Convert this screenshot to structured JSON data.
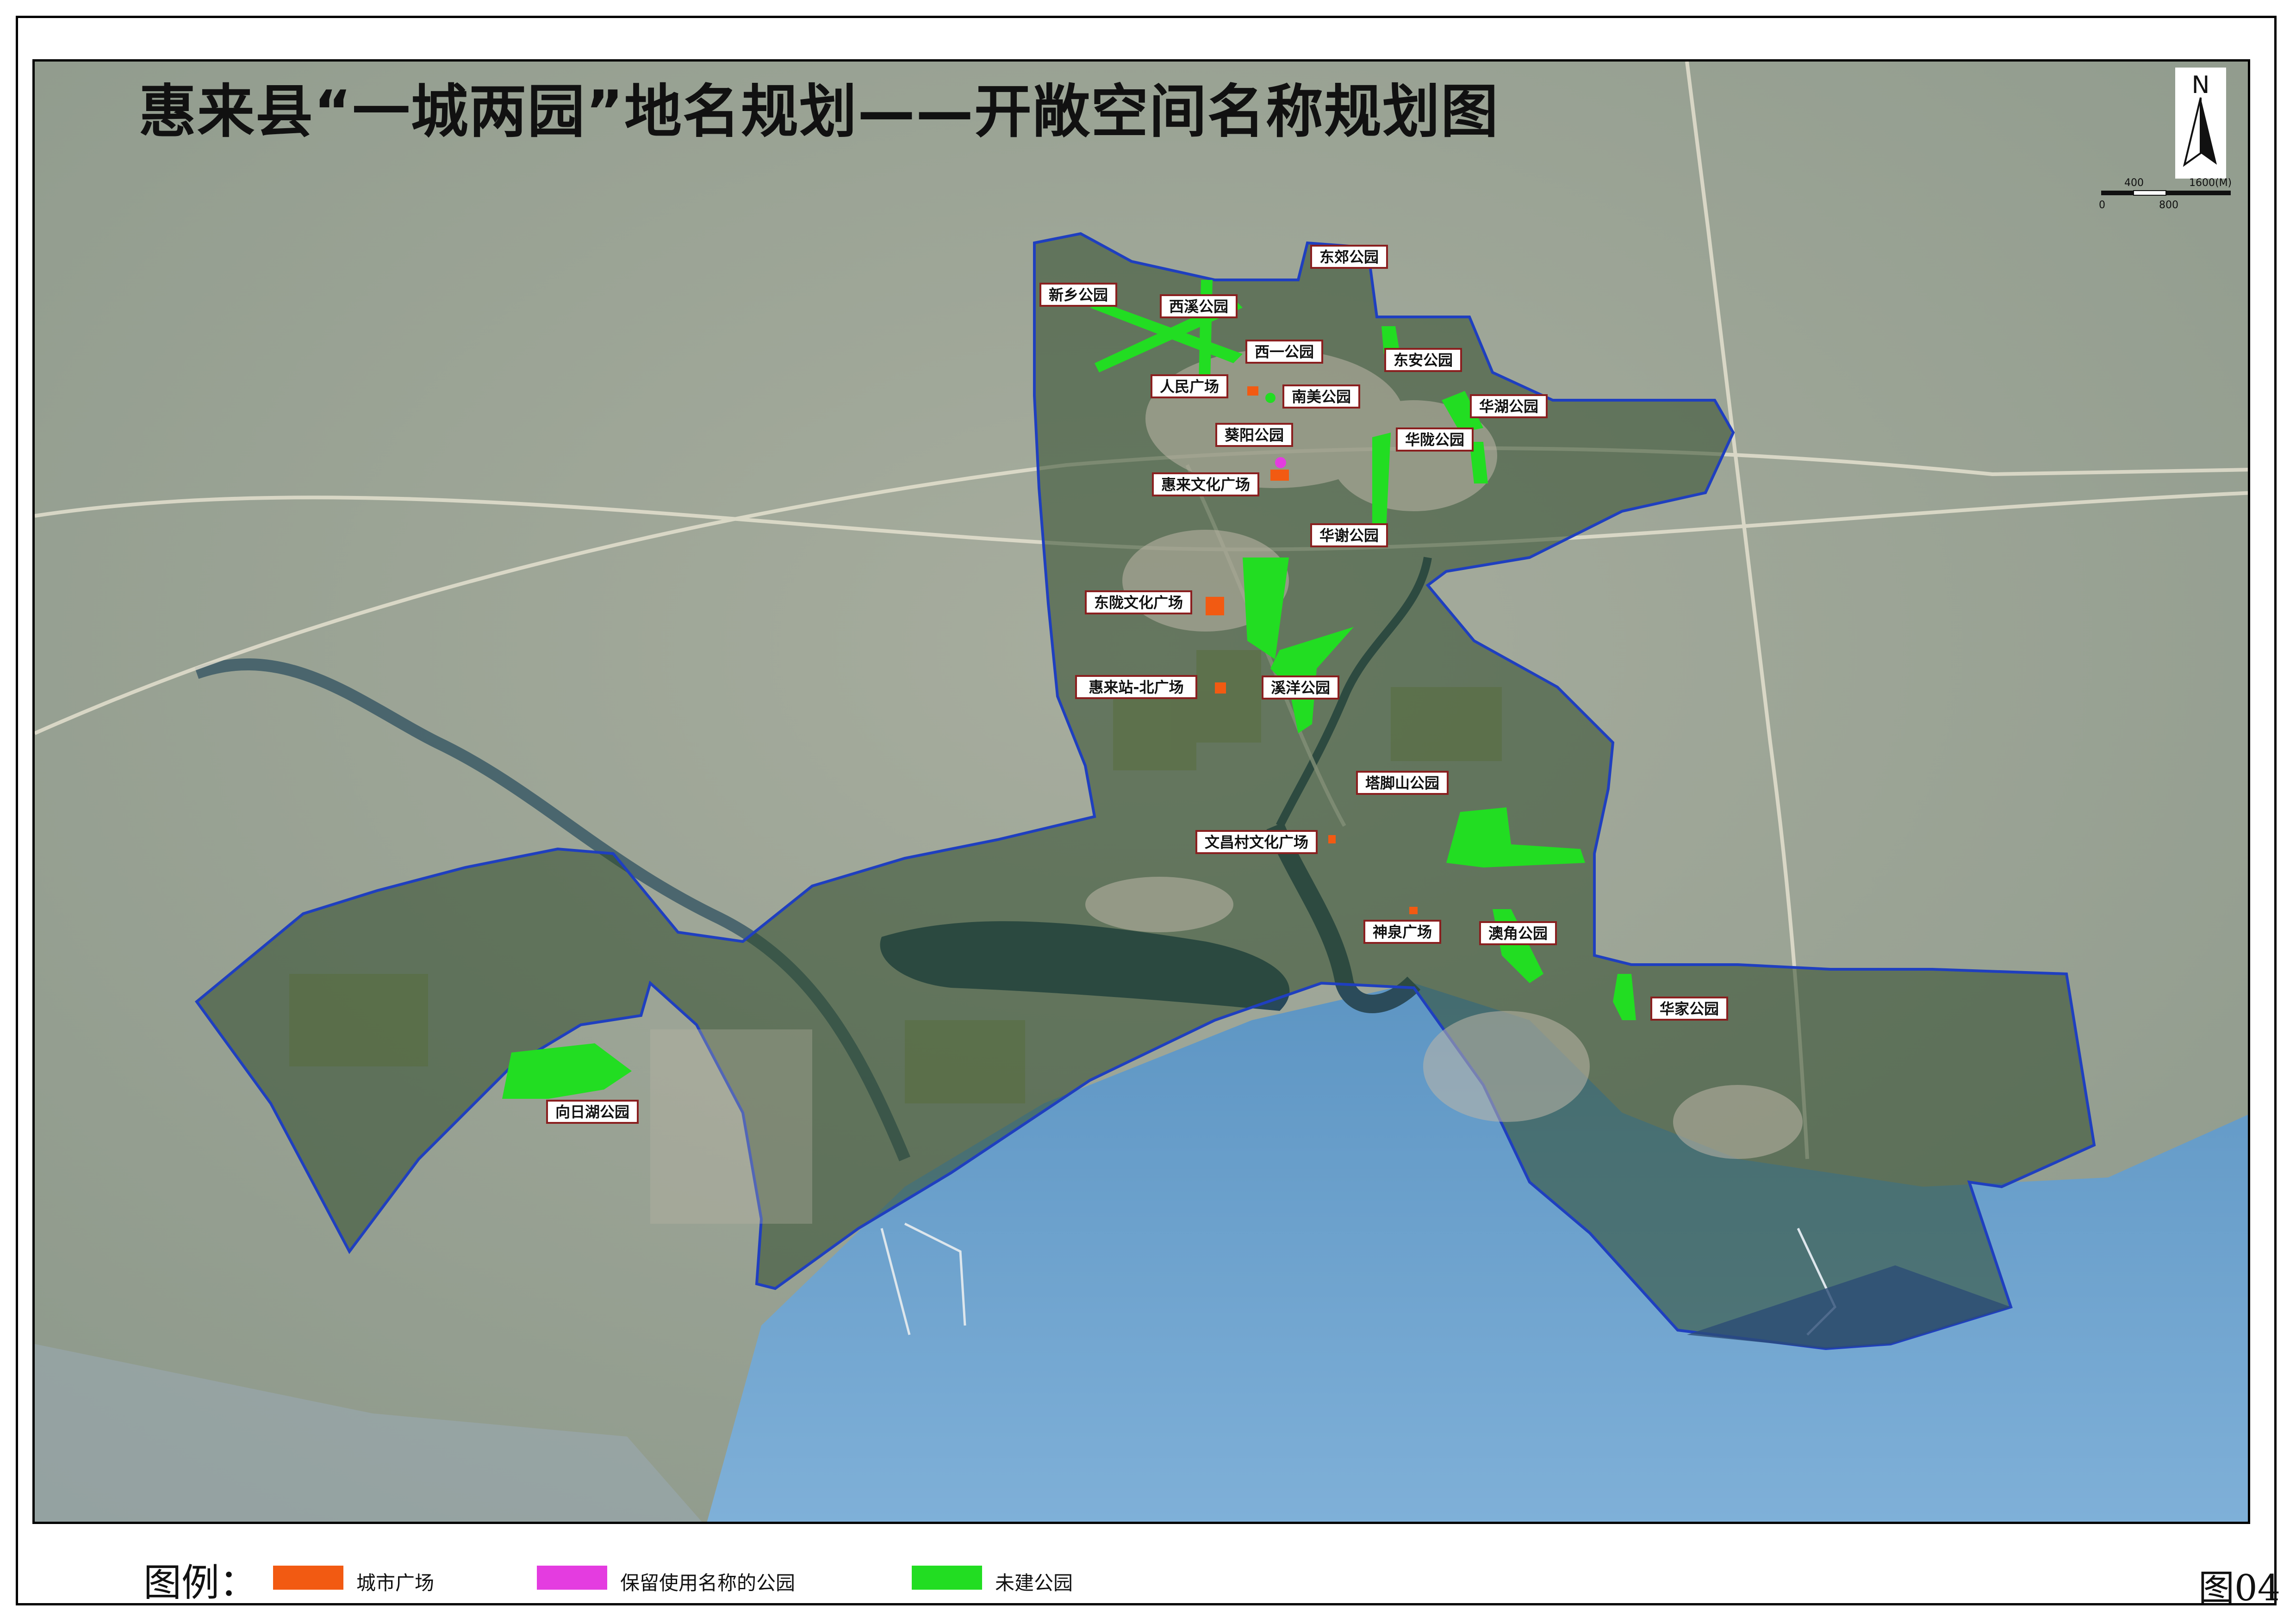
{
  "map": {
    "title": "惠来县“一城两园”地名规划——开敞空间名称规划图",
    "north_label": "N",
    "scale": {
      "tick_top": "400",
      "tick_right": "1600(M)",
      "tick_bottom_left": "0",
      "tick_bottom_mid": "800"
    },
    "colors": {
      "city_plaza": "#f25a12",
      "retained_park": "#e43ce0",
      "unbuilt_park": "#22dd22",
      "boundary": "#1f3fbf",
      "sea": "#4f88bb"
    },
    "places": [
      {
        "name": "东郊公园",
        "type": "park"
      },
      {
        "name": "新乡公园",
        "type": "park"
      },
      {
        "name": "西溪公园",
        "type": "park"
      },
      {
        "name": "西一公园",
        "type": "park"
      },
      {
        "name": "东安公园",
        "type": "park"
      },
      {
        "name": "人民广场",
        "type": "plaza"
      },
      {
        "name": "南美公园",
        "type": "park"
      },
      {
        "name": "华湖公园",
        "type": "park"
      },
      {
        "name": "葵阳公园",
        "type": "retained"
      },
      {
        "name": "华陇公园",
        "type": "park"
      },
      {
        "name": "惠来文化广场",
        "type": "plaza"
      },
      {
        "name": "华谢公园",
        "type": "park"
      },
      {
        "name": "东陇文化广场",
        "type": "plaza"
      },
      {
        "name": "惠来站-北广场",
        "type": "plaza"
      },
      {
        "name": "溪洋公园",
        "type": "park"
      },
      {
        "name": "塔脚山公园",
        "type": "park"
      },
      {
        "name": "文昌村文化广场",
        "type": "plaza"
      },
      {
        "name": "神泉广场",
        "type": "plaza"
      },
      {
        "name": "澳角公园",
        "type": "park"
      },
      {
        "name": "华家公园",
        "type": "park"
      },
      {
        "name": "向日湖公园",
        "type": "park"
      }
    ]
  },
  "legend": {
    "title": "图例：",
    "items": [
      {
        "label": "城市广场",
        "color": "#f25a12"
      },
      {
        "label": "保留使用名称的公园",
        "color": "#e43ce0"
      },
      {
        "label": "未建公园",
        "color": "#22dd22"
      }
    ]
  },
  "figure_number": "图04"
}
